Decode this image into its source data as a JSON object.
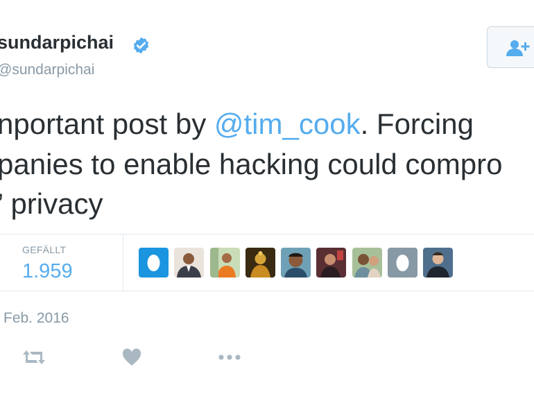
{
  "tweet": {
    "author_name": "sundarpichai",
    "author_handle": "@sundarpichai",
    "text_line1_before": "nportant post by ",
    "mention": "@tim_cook",
    "text_line1_after": ". Forcing",
    "text_line2": "panies to enable hacking could compro",
    "text_line3": "’ privacy",
    "date": "Feb. 2016"
  },
  "stats": {
    "likes_label": "GEFÄLLT",
    "likes_count": "1.959"
  },
  "colors": {
    "accent": "#55acee",
    "muted": "#8899a6",
    "text": "#292f33",
    "border": "#e1e8ed"
  },
  "icons": {
    "verified": "verified-badge-icon",
    "follow": "follow-user-icon",
    "retweet": "retweet-icon",
    "like": "heart-icon",
    "more": "more-dots-icon"
  }
}
